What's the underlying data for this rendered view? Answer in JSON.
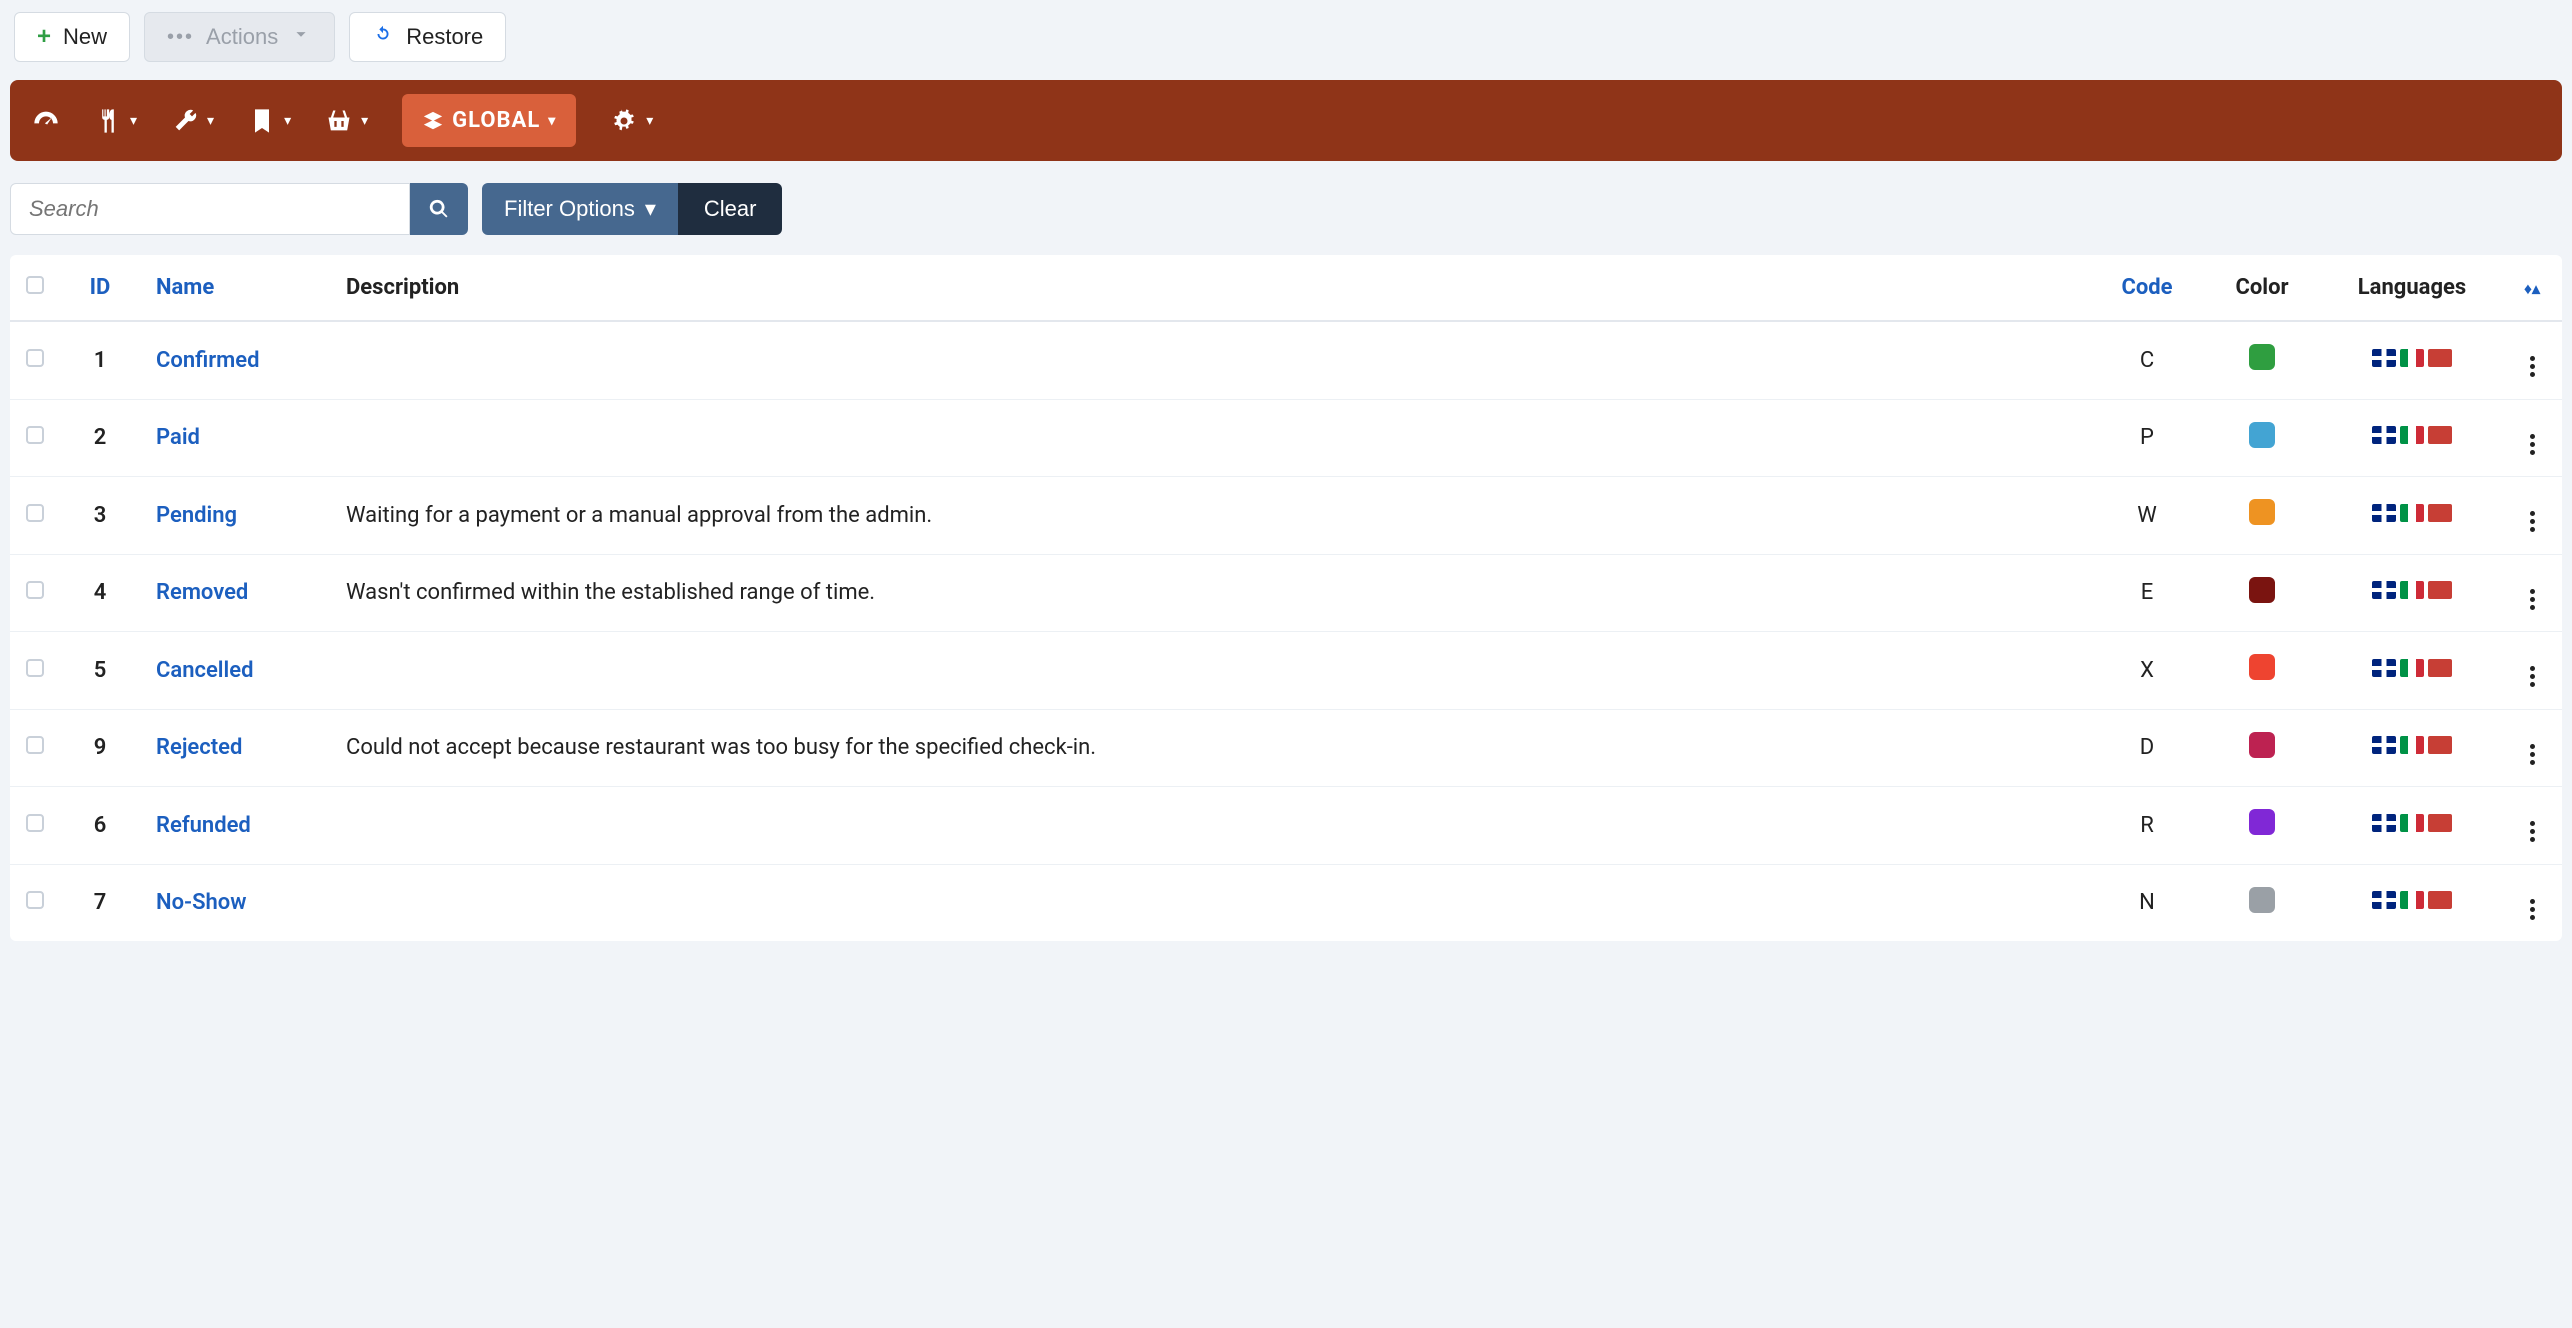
{
  "topbar": {
    "new_label": "New",
    "actions_label": "Actions",
    "restore_label": "Restore"
  },
  "navbar": {
    "global_label": "GLOBAL"
  },
  "filters": {
    "search_placeholder": "Search",
    "filter_options_label": "Filter Options",
    "clear_label": "Clear"
  },
  "columns": {
    "id": "ID",
    "name": "Name",
    "description": "Description",
    "code": "Code",
    "color": "Color",
    "languages": "Languages"
  },
  "rows": [
    {
      "id": "1",
      "name": "Confirmed",
      "description": "",
      "code": "C",
      "color": "#2f9e40"
    },
    {
      "id": "2",
      "name": "Paid",
      "description": "",
      "code": "P",
      "color": "#43a4d3"
    },
    {
      "id": "3",
      "name": "Pending",
      "description": "Waiting for a payment or a manual approval from the admin.",
      "code": "W",
      "color": "#ee9322"
    },
    {
      "id": "4",
      "name": "Removed",
      "description": "Wasn't confirmed within the established range of time.",
      "code": "E",
      "color": "#7a1410"
    },
    {
      "id": "5",
      "name": "Cancelled",
      "description": "",
      "code": "X",
      "color": "#ee4430"
    },
    {
      "id": "9",
      "name": "Rejected",
      "description": "Could not accept because restaurant was too busy for the specified check-in.",
      "code": "D",
      "color": "#bd2251"
    },
    {
      "id": "6",
      "name": "Refunded",
      "description": "",
      "code": "R",
      "color": "#8028d6"
    },
    {
      "id": "7",
      "name": "No-Show",
      "description": "",
      "code": "N",
      "color": "#9aa0a6"
    }
  ]
}
